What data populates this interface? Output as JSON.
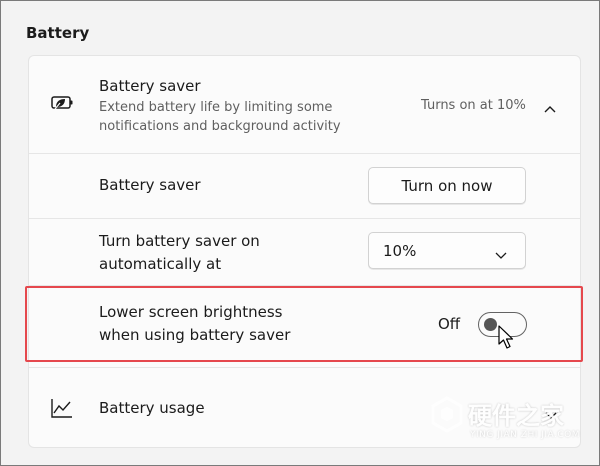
{
  "section": {
    "title": "Battery"
  },
  "battery_saver_header": {
    "icon": "battery-leaf-icon",
    "title": "Battery saver",
    "description_line1": "Extend battery life by limiting some",
    "description_line2": "notifications and background activity",
    "status": "Turns on at 10%",
    "expander_icon": "chevron-up-icon"
  },
  "battery_saver_row": {
    "label": "Battery saver",
    "button_label": "Turn on now"
  },
  "auto_row": {
    "label_line1": "Turn battery saver on",
    "label_line2": "automatically at",
    "selected": "10%",
    "dropdown_icon": "chevron-down-icon"
  },
  "brightness_row": {
    "label_line1": "Lower screen brightness",
    "label_line2": "when using battery saver",
    "toggle_state": "Off",
    "toggle_on": false,
    "highlight_color": "#e5484d"
  },
  "usage_row": {
    "icon": "line-chart-icon",
    "label": "Battery usage",
    "chevron_icon": "chevron-down-icon"
  },
  "watermark": {
    "logo": "hardware-home-logo",
    "text": "硬件之家",
    "subtext": "YING JIAN ZHI JIA.COM"
  }
}
